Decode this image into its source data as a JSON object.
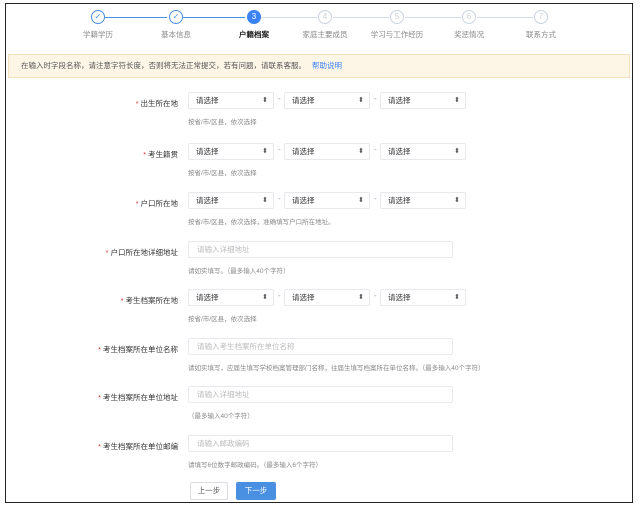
{
  "steps": [
    {
      "index": "✓",
      "label": "学籍学历",
      "state": "done"
    },
    {
      "index": "✓",
      "label": "基本信息",
      "state": "done"
    },
    {
      "index": "3",
      "label": "户籍档案",
      "state": "active"
    },
    {
      "index": "4",
      "label": "家庭主要成员",
      "state": "todo"
    },
    {
      "index": "5",
      "label": "学习与工作经历",
      "state": "todo"
    },
    {
      "index": "6",
      "label": "奖惩情况",
      "state": "todo"
    },
    {
      "index": "7",
      "label": "联系方式",
      "state": "todo"
    }
  ],
  "notice": {
    "text": "在输入时字段名称，请注意字符长度，否则将无法正常提交，若有问题，请联系客服。",
    "link": "帮助说明"
  },
  "form": {
    "birthplace": {
      "label": "出生所在地",
      "selects": [
        "请选择",
        "请选择",
        "请选择"
      ],
      "hint": "按省/市/区县，依次选择"
    },
    "native_place": {
      "label": "考生籍贯",
      "selects": [
        "请选择",
        "请选择",
        "请选择"
      ],
      "hint": "按省/市/区县，依次选择"
    },
    "hukou_location": {
      "label": "户口所在地",
      "selects": [
        "请选择",
        "请选择",
        "请选择"
      ],
      "hint": "按省/市/区县，依次选择，准确填写户口所在地址。"
    },
    "hukou_address": {
      "label": "户口所在地详细地址",
      "placeholder": "请输入详细地址",
      "hint": "请如实填写。（最多输入40个字符）"
    },
    "archive_location": {
      "label": "考生档案所在地",
      "selects": [
        "请选择",
        "请选择",
        "请选择"
      ],
      "hint": "按省/市/区县，依次选择"
    },
    "archive_unit_name": {
      "label": "考生档案所在单位名称",
      "placeholder": "请输入考生档案所在单位名称",
      "hint": "请如实填写，应届生填写学校档案管理部门名称，往届生填写档案所在单位名称。（最多输入40个字符）"
    },
    "archive_unit_address": {
      "label": "考生档案所在单位地址",
      "placeholder": "请输入详细地址",
      "hint": "（最多输入40个字符）"
    },
    "archive_unit_postcode": {
      "label": "考生档案所在单位邮编",
      "placeholder": "请输入邮政编码",
      "hint": "请填写6位数字邮政编码。（最多输入6个字符）"
    }
  },
  "buttons": {
    "prev": "上一步",
    "next": "下一步"
  },
  "colors": {
    "primary": "#4a90e2",
    "required": "#e03b3b",
    "notice_bg": "#fdf6e7"
  }
}
